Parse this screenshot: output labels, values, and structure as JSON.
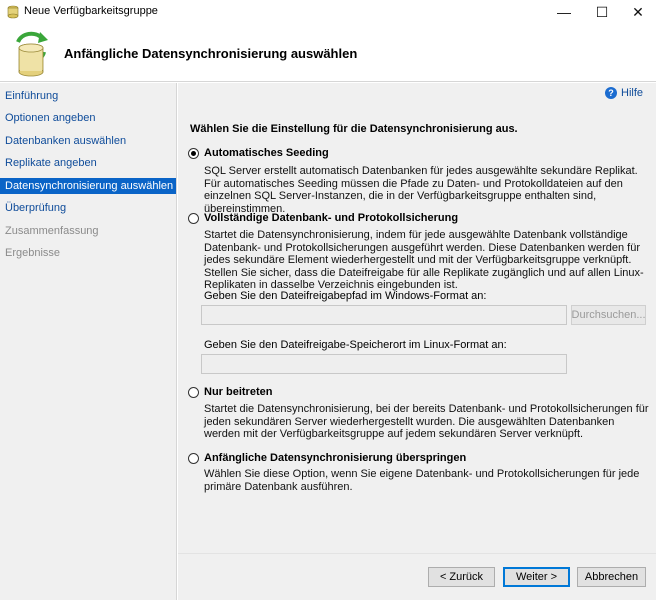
{
  "window": {
    "title": "Neue Verfügbarkeitsgruppe",
    "controls": {
      "minimize": "—",
      "maximize": "☐",
      "close": "✕"
    }
  },
  "header": {
    "title": "Anfängliche Datensynchronisierung auswählen",
    "icon": "database-sync-icon"
  },
  "nav": {
    "items": [
      {
        "label": "Einführung",
        "state": "link"
      },
      {
        "label": "Optionen angeben",
        "state": "link"
      },
      {
        "label": "Datenbanken auswählen",
        "state": "link"
      },
      {
        "label": "Replikate angeben",
        "state": "link"
      },
      {
        "label": "Datensynchronisierung auswählen",
        "state": "active"
      },
      {
        "label": "Überprüfung",
        "state": "link"
      },
      {
        "label": "Zusammenfassung",
        "state": "disabled"
      },
      {
        "label": "Ergebnisse",
        "state": "disabled"
      }
    ]
  },
  "help": {
    "label": "Hilfe",
    "icon": "help-icon"
  },
  "instruction": "Wählen Sie die Einstellung für die Datensynchronisierung aus.",
  "options": [
    {
      "label": "Automatisches Seeding",
      "selected": true,
      "description": "SQL Server erstellt automatisch Datenbanken für jedes ausgewählte sekundäre Replikat. Für automatisches Seeding müssen die Pfade zu Daten- und Protokolldateien auf den einzelnen SQL Server-Instanzen, die in der Verfügbarkeitsgruppe enthalten sind, übereinstimmen."
    },
    {
      "label": "Vollständige Datenbank- und Protokollsicherung",
      "selected": false,
      "description": "Startet die Datensynchronisierung, indem für jede ausgewählte Datenbank vollständige Datenbank- und Protokollsicherungen ausgeführt werden. Diese Datenbanken werden für jedes sekundäre Element wiederhergestellt und mit der Verfügbarkeitsgruppe verknüpft. Stellen Sie sicher, dass die Dateifreigabe für alle Replikate zugänglich und auf allen Linux-Replikaten in dasselbe Verzeichnis eingebunden ist."
    },
    {
      "label": "Nur beitreten",
      "selected": false,
      "description": "Startet die Datensynchronisierung, bei der bereits Datenbank- und Protokollsicherungen für jeden sekundären Server wiederhergestellt wurden. Die ausgewählten Datenbanken werden mit der Verfügbarkeitsgruppe auf jedem sekundären Server verknüpft."
    },
    {
      "label": "Anfängliche Datensynchronisierung überspringen",
      "selected": false,
      "description": "Wählen Sie diese Option, wenn Sie eigene Datenbank- und Protokollsicherungen für jede primäre Datenbank ausführen."
    }
  ],
  "fields": {
    "windows_share_label": "Geben Sie den Dateifreigabepfad im Windows-Format an:",
    "windows_share_value": "",
    "browse_label": "Durchsuchen...",
    "linux_share_label": "Geben Sie den Dateifreigabe-Speicherort im Linux-Format an:",
    "linux_share_value": ""
  },
  "buttons": {
    "back": "< Zurück",
    "next": "Weiter >",
    "cancel": "Abbrechen"
  },
  "colors": {
    "nav_active_bg": "#0a64c7",
    "link": "#0f4c9a",
    "panel_bg": "#f0f0f0"
  }
}
